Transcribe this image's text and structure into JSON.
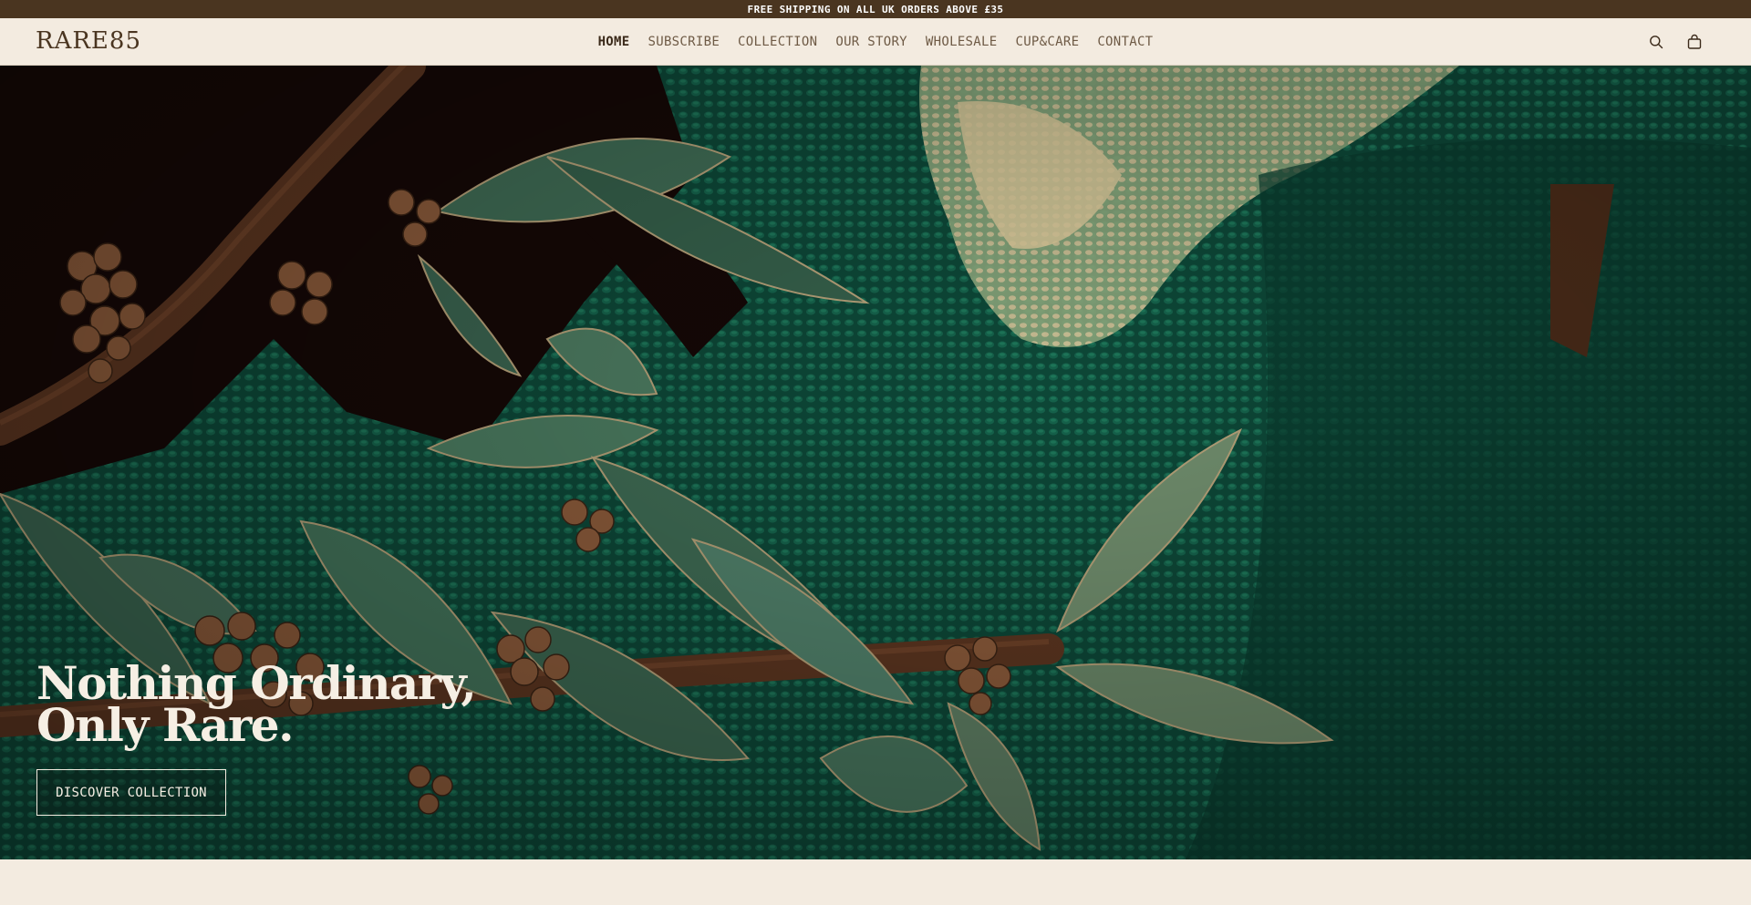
{
  "announcement": "FREE SHIPPING ON ALL UK ORDERS ABOVE £35",
  "header": {
    "logo": "RARE85",
    "nav": [
      {
        "label": "HOME",
        "active": true
      },
      {
        "label": "SUBSCRIBE"
      },
      {
        "label": "COLLECTION"
      },
      {
        "label": "OUR STORY"
      },
      {
        "label": "WHOLESALE"
      },
      {
        "label": "CUP&CARE"
      },
      {
        "label": "CONTACT"
      }
    ],
    "icons": [
      "search-icon",
      "shopping-bag-icon"
    ]
  },
  "hero": {
    "title_line1": "Nothing Ordinary,",
    "title_line2": "Only Rare.",
    "cta": "DISCOVER COLLECTION"
  },
  "colors": {
    "announcement_bg": "#4a3520",
    "page_bg": "#f3ebe0",
    "brand_brown": "#4a3520",
    "forest_green": "#0c3a2f"
  }
}
